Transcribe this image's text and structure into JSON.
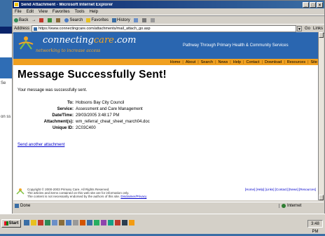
{
  "window": {
    "title": "Send Attachment - Microsoft Internet Explorer",
    "controls": {
      "minimize": "_",
      "maximize": "□",
      "close": "×"
    }
  },
  "menu": [
    "File",
    "Edit",
    "View",
    "Favorites",
    "Tools",
    "Help"
  ],
  "toolbar": {
    "back": "Back",
    "forward": "→",
    "search": "Search",
    "favorites": "Favorites",
    "history": "History"
  },
  "address": {
    "label": "Address",
    "url": "https://www.connectingcare.com/attachments/mail_attach_go.asp",
    "go": "Go",
    "links": "Links"
  },
  "site": {
    "logo_prefix": "connecting",
    "logo_highlight": "care",
    "logo_suffix": ".com",
    "tagline": "networking to increase access",
    "slogan": "Pathway Through Primary Health & Community Services",
    "nav": [
      "Home",
      "About",
      "Search",
      "News",
      "Help",
      "Contact",
      "Download",
      "Resources",
      "Site"
    ]
  },
  "message": {
    "headline": "Message Successfully Sent!",
    "intro": "Your message was successfully sent.",
    "fields": [
      {
        "key": "To:",
        "value": "Hobsons Bay City Council"
      },
      {
        "key": "Service:",
        "value": "Assessment and Care Management"
      },
      {
        "key": "Date/Time:",
        "value": "29/03/2005 3:48:17 PM"
      },
      {
        "key": "Attachment(s):",
        "value": "wm_referral_cheat_sheet_march04.doc"
      },
      {
        "key": "Unique ID:",
        "value": "2C03C400"
      }
    ],
    "send_link": "Send another attachment"
  },
  "footer": {
    "copyright": "Copyright © 2000-2003 Primary Care. All Rights Reserved.",
    "line2": "The articles and items contained on this web site are for information only.",
    "line3_prefix": "The content is not necessarily endorsed by the authors of this site.",
    "disclaimer_link": "Disclaimer/Privacy",
    "links": "[Home] [Help] [Links] [Contact] [News] [Resources]"
  },
  "status": {
    "text": "Done",
    "zone": "Internet"
  },
  "taskbar": {
    "start": "Start",
    "clock": "3:48 PM"
  },
  "background_window": {
    "line1": "Se",
    "line2": "on ss"
  },
  "colors": {
    "header_blue": "#2a66b0",
    "nav_orange": "#f0a020",
    "logo_orange": "#f5a623",
    "title_blue": "#0a246a"
  }
}
